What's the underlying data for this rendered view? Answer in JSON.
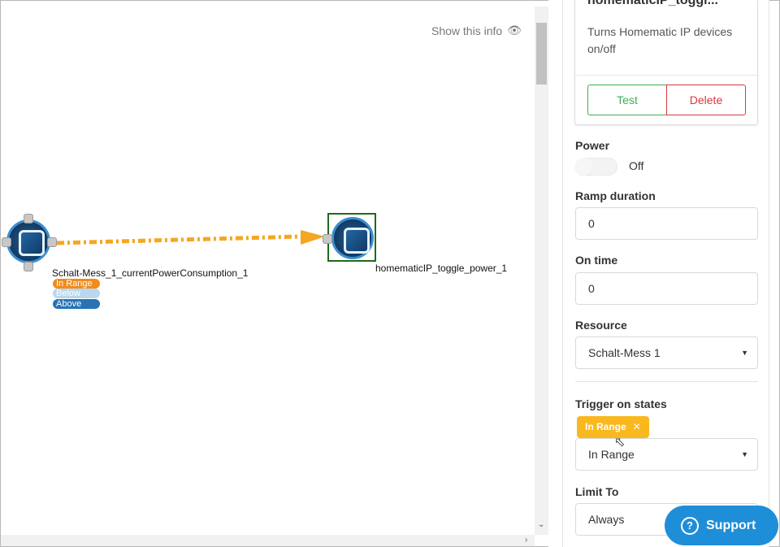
{
  "canvas": {
    "show_info_label": "Show this info",
    "source_node": {
      "label": "Schalt-Mess_1_currentPowerConsumption_1",
      "states": [
        "In Range",
        "Below",
        "Above"
      ]
    },
    "target_node": {
      "label": "homematicIP_toggle_power_1"
    },
    "edge_color": "#f5a623"
  },
  "panel": {
    "card": {
      "title": "homematicIP_toggl...",
      "description": "Turns Homematic IP devices on/off",
      "test_label": "Test",
      "delete_label": "Delete"
    },
    "power": {
      "label": "Power",
      "state_text": "Off"
    },
    "ramp_duration": {
      "label": "Ramp duration",
      "value": "0"
    },
    "on_time": {
      "label": "On time",
      "value": "0"
    },
    "resource": {
      "label": "Resource",
      "value": "Schalt-Mess 1"
    },
    "trigger": {
      "label": "Trigger on states",
      "selected_tags": [
        "In Range"
      ],
      "value": "In Range"
    },
    "limit_to": {
      "label": "Limit To",
      "value": "Always"
    }
  },
  "support": {
    "label": "Support"
  },
  "colors": {
    "test": "#3fae55",
    "delete": "#d9363e",
    "tag": "#f9b81e",
    "support": "#1f8ed8",
    "state_in_range": "#f08c1e",
    "state_below": "#b9d7ef",
    "state_above": "#2773b5"
  }
}
